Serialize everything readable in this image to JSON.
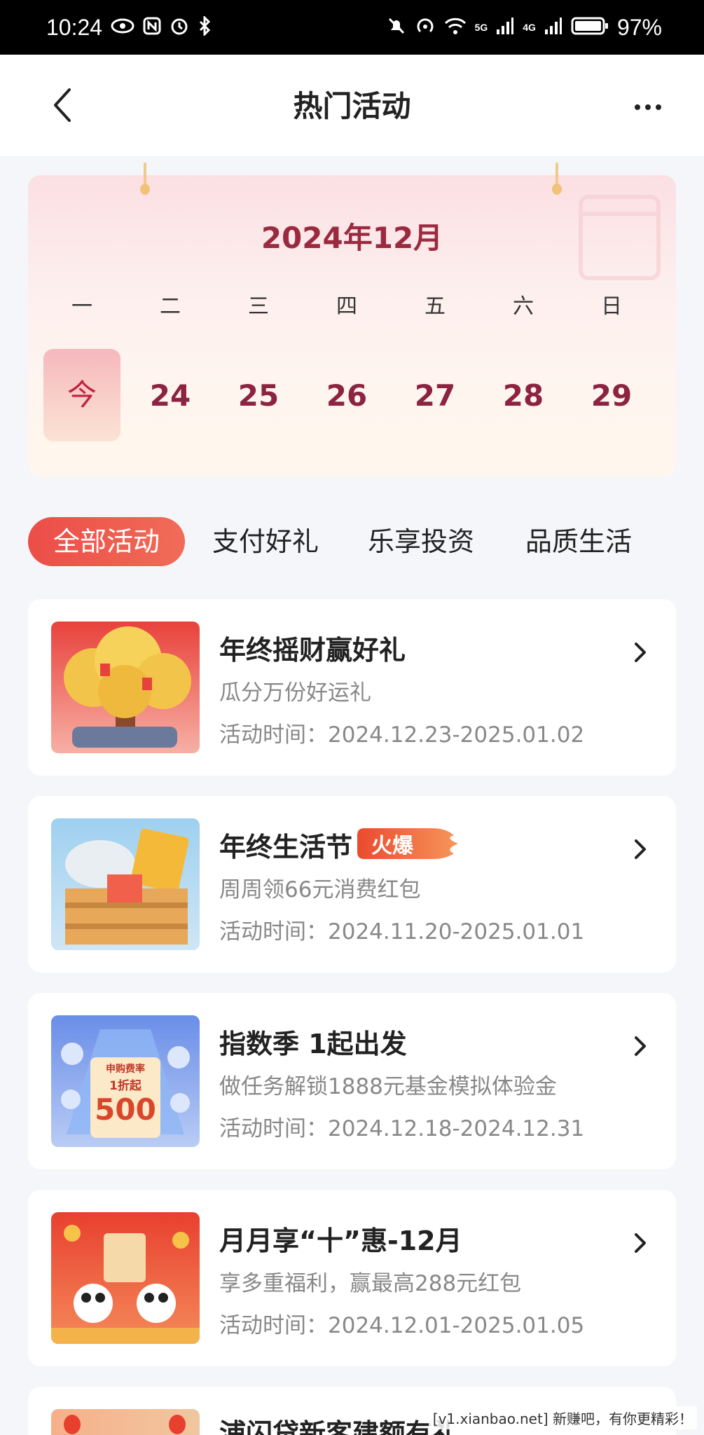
{
  "status_bar": {
    "time": "10:24",
    "battery": "97%",
    "network_5g": "5G",
    "network_4g": "4G",
    "icons": [
      "eye-icon",
      "nfc-icon",
      "alarm-icon",
      "bluetooth-icon",
      "mute-icon",
      "hotspot-icon",
      "wifi-icon",
      "signal-icon",
      "battery-icon"
    ]
  },
  "header": {
    "title": "热门活动"
  },
  "calendar": {
    "title": "2024年12月",
    "weekdays": [
      "一",
      "二",
      "三",
      "四",
      "五",
      "六",
      "日"
    ],
    "days": [
      "今",
      "24",
      "25",
      "26",
      "27",
      "28",
      "29"
    ]
  },
  "tabs": [
    {
      "label": "全部活动",
      "active": true
    },
    {
      "label": "支付好礼",
      "active": false
    },
    {
      "label": "乐享投资",
      "active": false
    },
    {
      "label": "品质生活",
      "active": false
    }
  ],
  "activities": [
    {
      "title": "年终摇财赢好礼",
      "subtitle": "瓜分万份好运礼",
      "time": "活动时间：2024.12.23-2025.01.02"
    },
    {
      "title": "年终生活节",
      "badge": "火爆",
      "subtitle": "周周领66元消费红包",
      "time": "活动时间：2024.11.20-2025.01.01"
    },
    {
      "title": "指数季 1起出发",
      "subtitle": "做任务解锁1888元基金模拟体验金",
      "time": "活动时间：2024.12.18-2024.12.31",
      "thumb_text_top": "申购费率",
      "thumb_text_mid": "1折起",
      "thumb_text_num": "500"
    },
    {
      "title": "月月享“十”惠-12月",
      "subtitle": "享多重福利，赢最高288元红包",
      "time": "活动时间：2024.12.01-2025.01.05"
    },
    {
      "title": "浦闪贷新客建额有礼"
    }
  ],
  "watermark": "[v1.xianbao.net] 新赚吧，有你更精彩！",
  "colors": {
    "accent": "#ec4d48",
    "calendar_text": "#9b2a3f",
    "badge": "#ef5a3c"
  }
}
